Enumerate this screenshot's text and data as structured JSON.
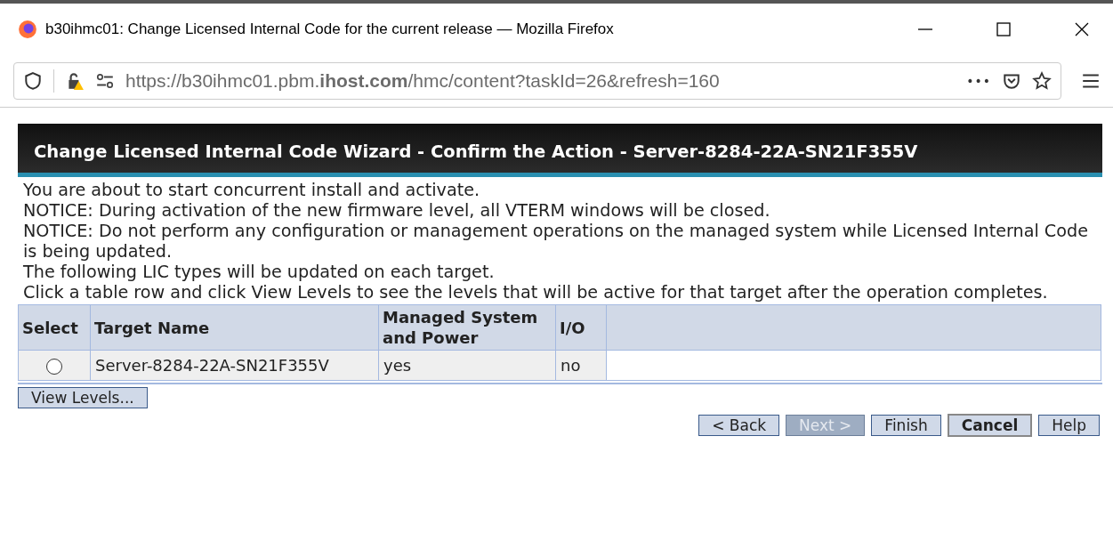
{
  "window": {
    "title": "b30ihmc01: Change Licensed Internal Code for the current release — Mozilla Firefox"
  },
  "address_bar": {
    "url": "https://b30ihmc01.pbm.**ihost.com**/hmc/content?taskId=26&refresh=160",
    "menu_glyph": "•••"
  },
  "page": {
    "title": "Change Licensed Internal Code Wizard - Confirm the Action - Server-8284-22A-SN21F355V",
    "messages": [
      "You are about to start concurrent install and activate.",
      "NOTICE: During activation of the new firmware level, all VTERM windows will be closed.",
      "NOTICE: Do not perform any configuration or management operations on the managed system while Licensed Internal Code is being updated.",
      "The following LIC types will be updated on each target.",
      "Click a table row and click View Levels to see the levels that will be active for that target after the operation completes."
    ],
    "table": {
      "columns": [
        "Select",
        "Target Name",
        "Managed System and Power",
        "I/O"
      ],
      "rows": [
        {
          "selected": false,
          "cells": [
            "",
            "Server-8284-22A-SN21F355V",
            "yes",
            "no"
          ]
        }
      ]
    },
    "view_button": "View Levels...",
    "buttons": [
      {
        "label": "< Back",
        "disabled": false,
        "default": false
      },
      {
        "label": "Next >",
        "disabled": true,
        "default": false
      },
      {
        "label": "Finish",
        "disabled": false,
        "default": false
      },
      {
        "label": "Cancel",
        "disabled": false,
        "default": true
      },
      {
        "label": "Help",
        "disabled": false,
        "default": false
      }
    ]
  }
}
